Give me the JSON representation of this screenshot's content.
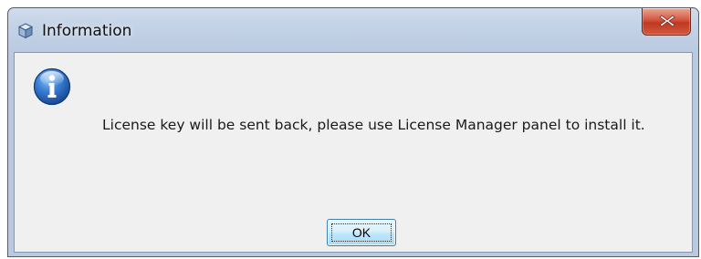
{
  "window": {
    "title": "Information",
    "title_icon": "app-cube-icon",
    "close_icon": "close-x-icon"
  },
  "dialog": {
    "icon": "info-icon",
    "message": "License key will be sent back, please use License Manager panel to install it.",
    "ok_label": "OK"
  },
  "colors": {
    "frame": "#b9c9df",
    "client_bg": "#f0f0f0",
    "close_button": "#c13722",
    "info_icon": "#2f6fc4"
  }
}
